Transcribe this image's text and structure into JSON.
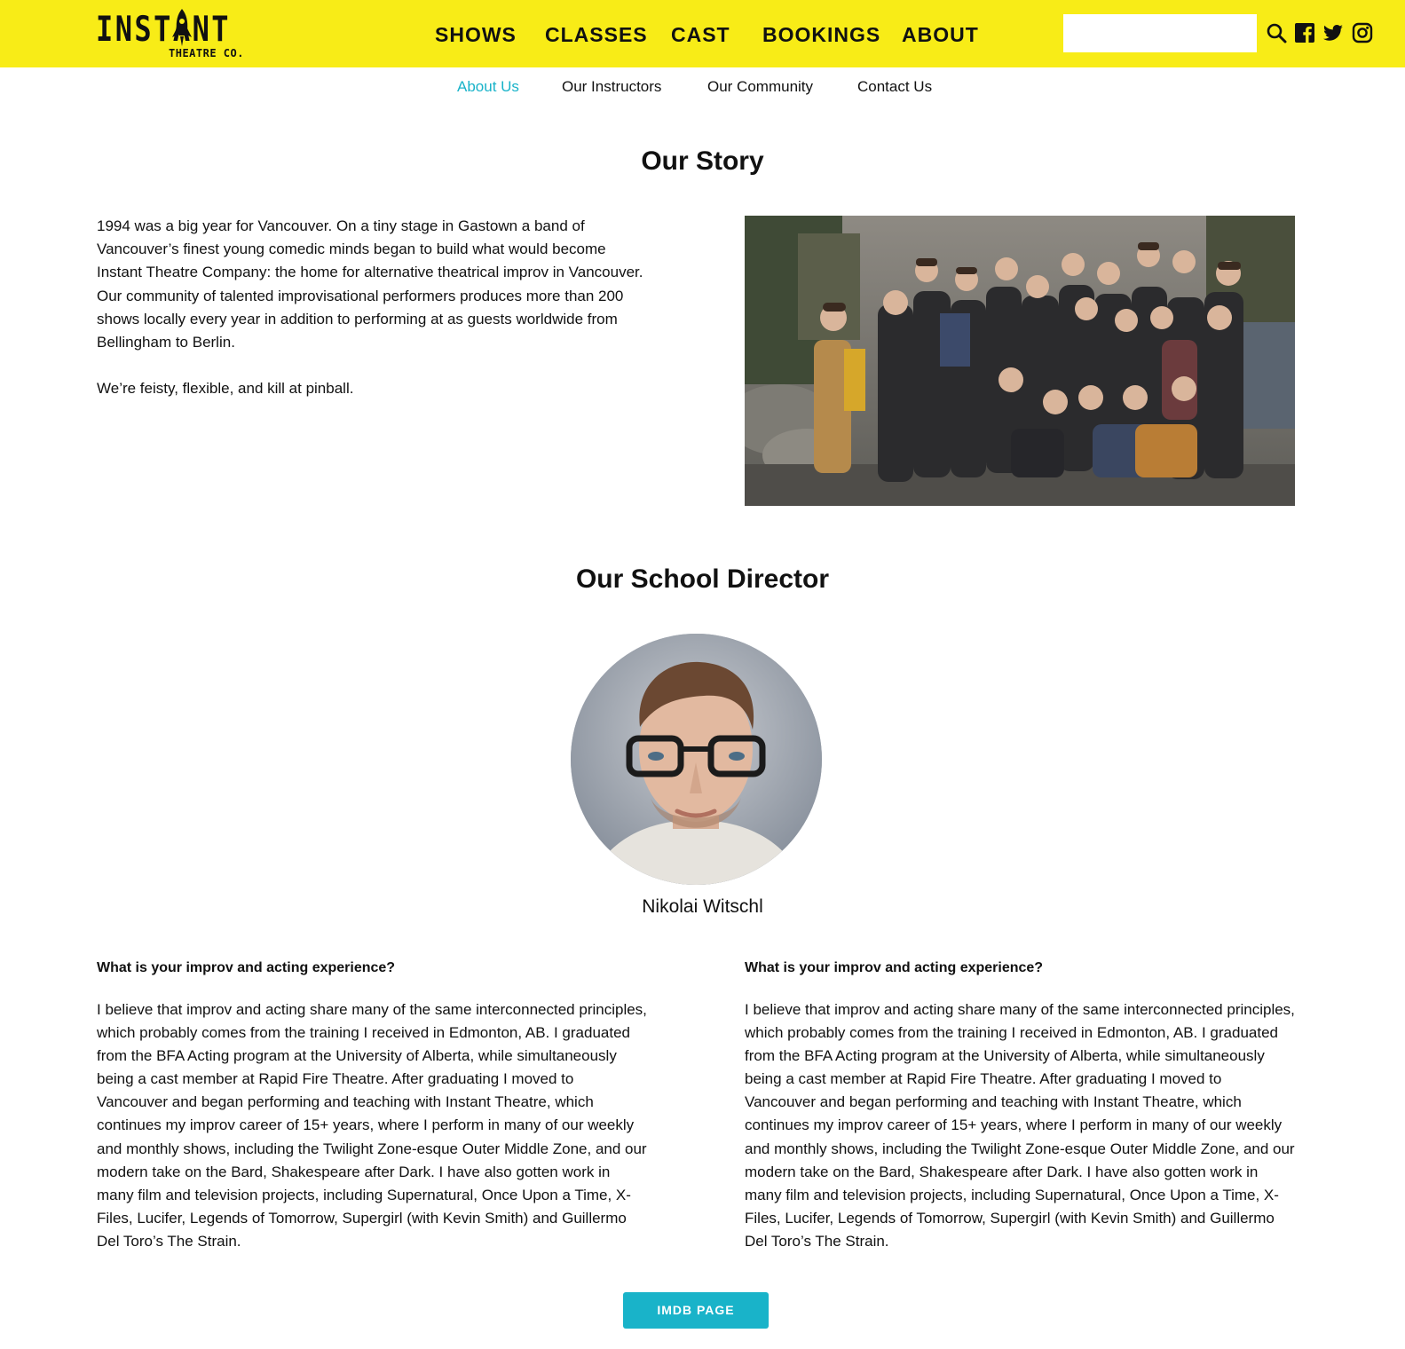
{
  "brand": {
    "logo_main": "INSTANT",
    "logo_sub": "THEATRE CO."
  },
  "main_nav": {
    "items": [
      {
        "label": "SHOWS"
      },
      {
        "label": "CLASSES"
      },
      {
        "label": "CAST"
      },
      {
        "label": "BOOKINGS"
      },
      {
        "label": "ABOUT"
      }
    ]
  },
  "header": {
    "search_placeholder": "",
    "icons": [
      "search-icon",
      "facebook-icon",
      "twitter-icon",
      "instagram-icon"
    ]
  },
  "sub_nav": {
    "items": [
      {
        "label": "About Us",
        "active": true
      },
      {
        "label": "Our Instructors",
        "active": false
      },
      {
        "label": "Our Community",
        "active": false
      },
      {
        "label": "Contact Us",
        "active": false
      }
    ]
  },
  "story": {
    "title": "Our Story",
    "paragraphs": [
      "1994 was a big year for Vancouver. On a tiny stage in Gastown a band of Vancouver’s finest young comedic minds began to build what would become Instant Theatre Company: the home for alternative theatrical improv in Vancouver. Our community of talented improvisational performers produces more than 200 shows locally every year in addition to performing at as guests worldwide from Bellingham to Berlin.",
      "We’re feisty, flexible, and kill at pinball."
    ]
  },
  "director": {
    "title": "Our School Director",
    "name": "Nikolai Witschl",
    "qa": [
      {
        "question": "What is your improv and acting experience?",
        "answer": "I believe that improv and acting share many of the same interconnected principles, which probably comes from the training I received in Edmonton, AB. I graduated from the BFA Acting program at the University of Alberta, while simultaneously being a cast member at Rapid Fire Theatre. After graduating I moved to Vancouver and began performing and teaching with Instant Theatre, which continues my improv career of 15+ years, where I perform in many of our weekly and monthly shows, including the Twilight Zone-esque Outer Middle Zone, and our modern take on the Bard, Shakespeare after Dark. I have also gotten work in many film and television projects, including Supernatural, Once Upon a Time, X-Files, Lucifer, Legends of Tomorrow, Supergirl (with Kevin Smith) and Guillermo Del Toro’s The Strain."
      },
      {
        "question": "What is your improv and acting experience?",
        "answer": "I believe that improv and acting share many of the same interconnected principles, which probably comes from the training I received in Edmonton, AB. I graduated from the BFA Acting program at the University of Alberta, while simultaneously being a cast member at Rapid Fire Theatre. After graduating I moved to Vancouver and began performing and teaching with Instant Theatre, which continues my improv career of 15+ years, where I perform in many of our weekly and monthly shows, including the Twilight Zone-esque Outer Middle Zone, and our modern take on the Bard, Shakespeare after Dark. I have also gotten work in many film and television projects, including Supernatural, Once Upon a Time, X-Files, Lucifer, Legends of Tomorrow, Supergirl (with Kevin Smith) and Guillermo Del Toro’s The Strain."
      }
    ],
    "button_label": "IMDB PAGE"
  },
  "colors": {
    "header_bg": "#f8ec17",
    "accent": "#19b3c9",
    "text": "#111111"
  }
}
